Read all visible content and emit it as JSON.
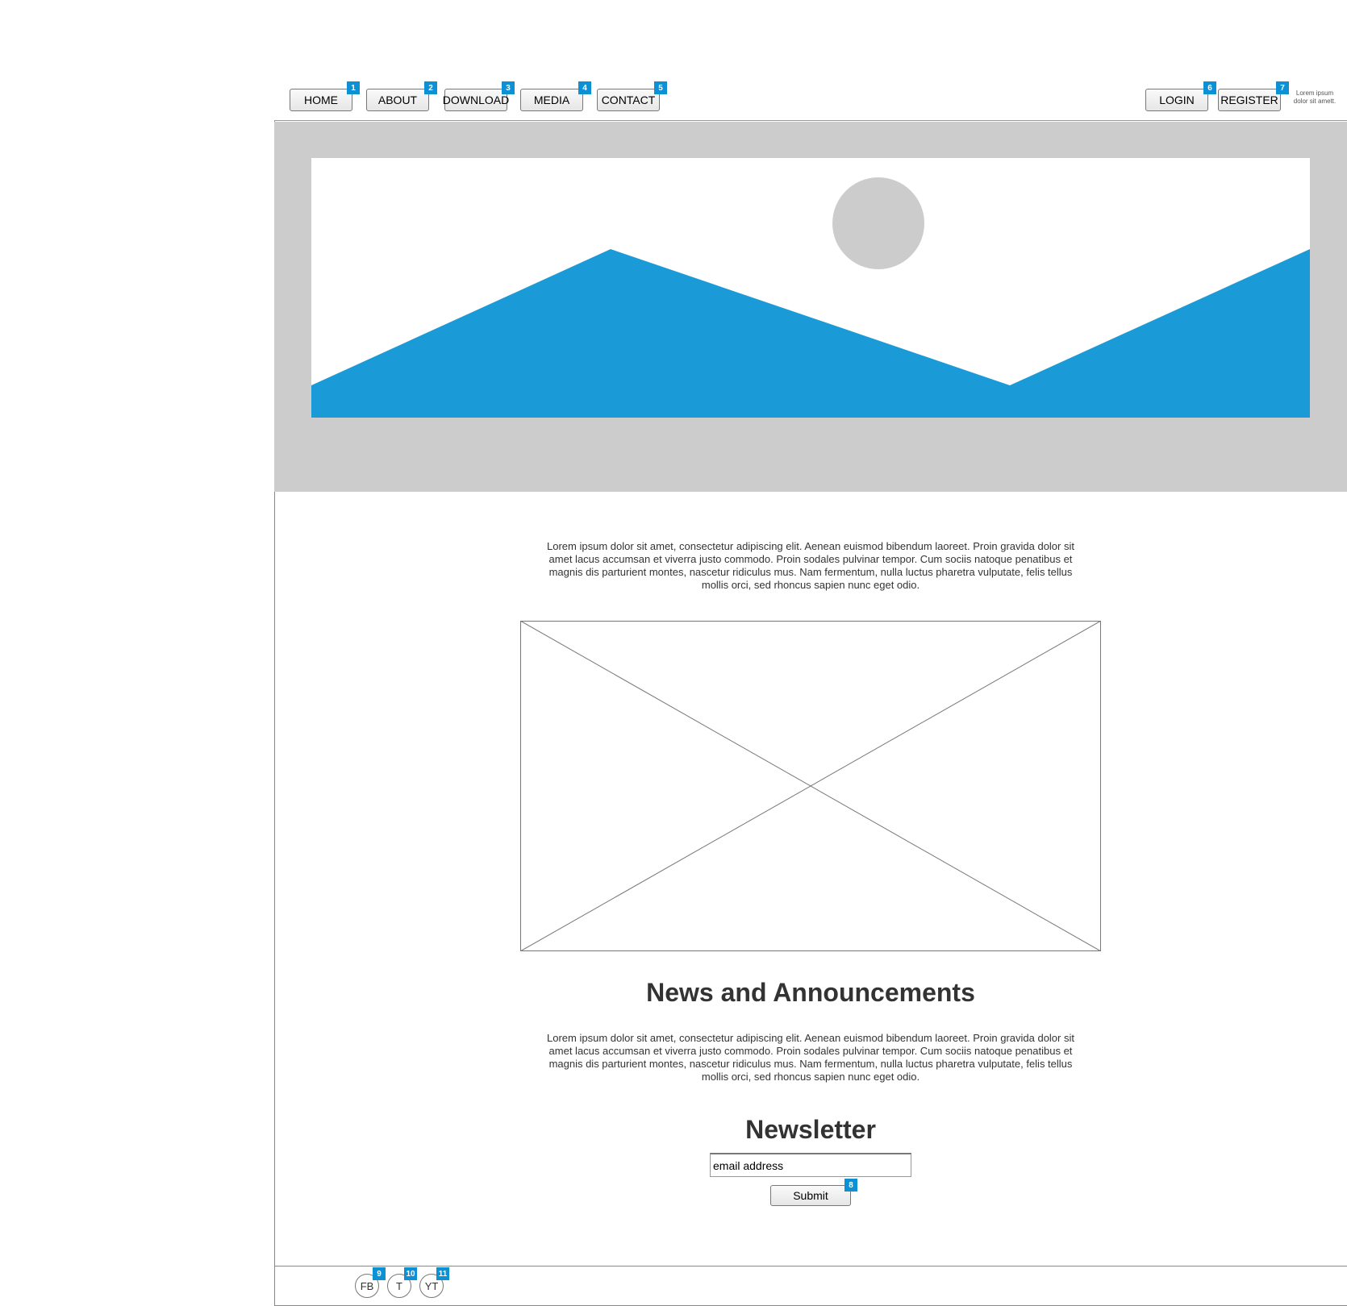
{
  "nav": {
    "left": [
      {
        "label": "HOME",
        "badge": "1"
      },
      {
        "label": "ABOUT",
        "badge": "2"
      },
      {
        "label": "DOWNLOAD",
        "badge": "3"
      },
      {
        "label": "MEDIA",
        "badge": "4"
      },
      {
        "label": "CONTACT",
        "badge": "5"
      }
    ],
    "right": [
      {
        "label": "LOGIN",
        "badge": "6"
      },
      {
        "label": "REGISTER",
        "badge": "7"
      }
    ],
    "side_text": "Lorem ipsum dolor sit amett."
  },
  "hero": {
    "icon": "image-placeholder-icon",
    "colors": {
      "background": "#cccccc",
      "mountain": "#1a9ad6",
      "sun": "#cccccc"
    }
  },
  "intro": {
    "text": "Lorem ipsum dolor sit amet, consectetur adipiscing elit. Aenean euismod bibendum laoreet. Proin gravida dolor sit amet lacus accumsan et viverra justo commodo. Proin sodales pulvinar tempor. Cum sociis natoque penatibus et magnis dis parturient montes, nascetur ridiculus mus. Nam fermentum, nulla luctus pharetra vulputate, felis tellus mollis orci, sed rhoncus sapien nunc eget odio."
  },
  "news": {
    "heading": "News and Announcements",
    "text": "Lorem ipsum dolor sit amet, consectetur adipiscing elit. Aenean euismod bibendum laoreet. Proin gravida dolor sit amet lacus accumsan et viverra justo commodo. Proin sodales pulvinar tempor. Cum sociis natoque penatibus et magnis dis parturient montes, nascetur ridiculus mus. Nam fermentum, nulla luctus pharetra vulputate, felis tellus mollis orci, sed rhoncus sapien nunc eget odio."
  },
  "newsletter": {
    "heading": "Newsletter",
    "email_placeholder": "email address",
    "email_value": "",
    "submit_label": "Submit",
    "submit_badge": "8"
  },
  "footer": {
    "social": [
      {
        "label": "FB",
        "badge": "9"
      },
      {
        "label": "T",
        "badge": "10"
      },
      {
        "label": "YT",
        "badge": "11"
      }
    ]
  },
  "colors": {
    "badge": "#0b91d4",
    "accent": "#1a9ad6"
  }
}
